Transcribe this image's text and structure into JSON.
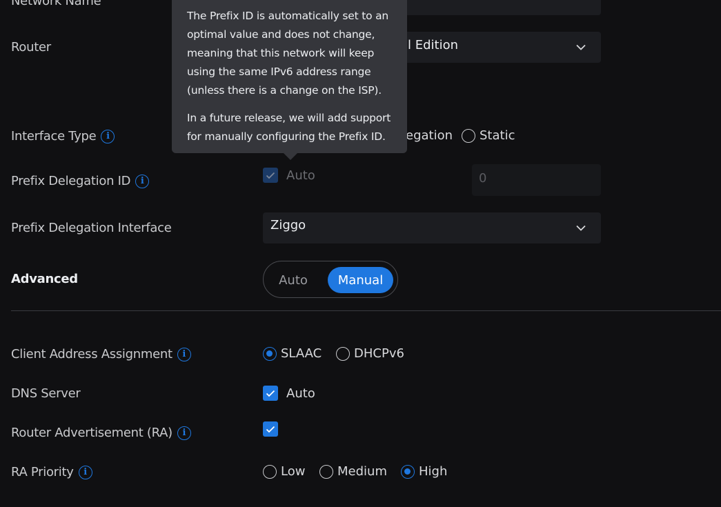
{
  "labels": {
    "network_name": "Network Name",
    "router": "Router",
    "interface_type": "Interface Type",
    "prefix_delegation_id": "Prefix Delegation ID",
    "prefix_delegation_interface": "Prefix Delegation Interface",
    "advanced": "Advanced",
    "client_address_assignment": "Client Address Assignment",
    "dns_server": "DNS Server",
    "router_advertisement": "Router Advertisement (RA)",
    "ra_priority": "RA Priority"
  },
  "router_select": {
    "value": "l Edition"
  },
  "interface_type": {
    "visible_option": "egation",
    "static": "Static"
  },
  "prefix_id": {
    "auto_label": "Auto",
    "value": "0"
  },
  "pd_interface_select": {
    "value": "Ziggo"
  },
  "advanced_toggle": {
    "auto": "Auto",
    "manual": "Manual",
    "selected": "Manual"
  },
  "client_address": {
    "slaac": "SLAAC",
    "dhcpv6": "DHCPv6",
    "selected": "SLAAC"
  },
  "dns": {
    "auto_label": "Auto",
    "checked": true
  },
  "ra": {
    "checked": true
  },
  "ra_priority": {
    "low": "Low",
    "medium": "Medium",
    "high": "High",
    "selected": "High"
  },
  "tooltip": {
    "para1": "The Prefix ID is automatically set to an optimal value and does not change, meaning that this network will keep using the same IPv6 address range (unless there is a change on the ISP).",
    "para2": "In a future release, we will add support for manually configuring the Prefix ID."
  },
  "colors": {
    "accent": "#1f78e0",
    "background": "#101012",
    "tooltip": "#35363b"
  }
}
